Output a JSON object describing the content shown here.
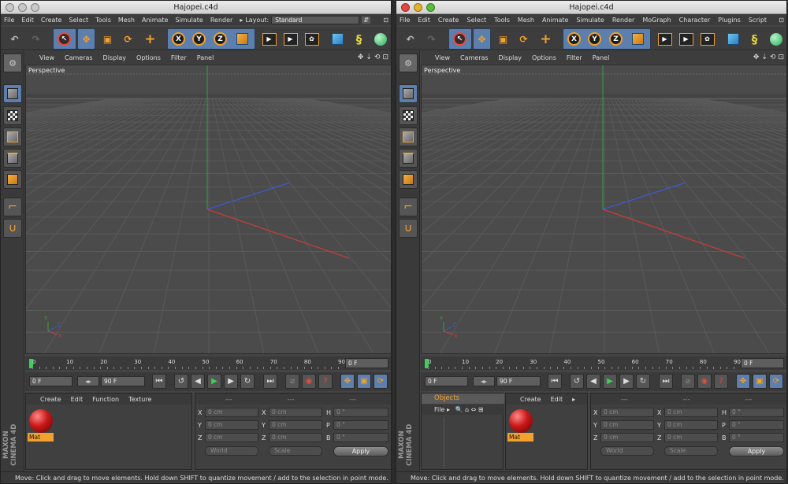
{
  "windows": [
    {
      "title": "Hajopei.c4d",
      "menu": [
        "File",
        "Edit",
        "Create",
        "Select",
        "Tools",
        "Mesh",
        "Animate",
        "Simulate",
        "Render"
      ],
      "layout_label": "Layout:",
      "layout_value": "Standard",
      "traffic_lights_active": false
    },
    {
      "title": "Hajopei.c4d",
      "menu": [
        "File",
        "Edit",
        "Create",
        "Select",
        "Tools",
        "Mesh",
        "Animate",
        "Simulate",
        "Render",
        "MoGraph",
        "Character",
        "Plugins",
        "Script"
      ],
      "traffic_lights_active": true
    }
  ],
  "viewport_menu": [
    "View",
    "Cameras",
    "Display",
    "Options",
    "Filter",
    "Panel"
  ],
  "viewport_label": "Perspective",
  "timeline": {
    "ticks": [
      "0",
      "10",
      "20",
      "30",
      "40",
      "50",
      "60",
      "70",
      "80",
      "90"
    ],
    "end_frame": "0 F",
    "start_field": "0 F",
    "max_field": "90 F"
  },
  "material_menu": [
    "Create",
    "Edit",
    "Function",
    "Texture"
  ],
  "material_menu_right": [
    "Create",
    "Edit"
  ],
  "material_name": "Mat",
  "objects_tab": "Objects",
  "objects_file_menu": "File",
  "attributes": {
    "header": [
      "---",
      "---",
      "---"
    ],
    "rows": [
      {
        "a": "X",
        "a_val": "0 cm",
        "b": "X",
        "b_val": "0 cm",
        "c": "H",
        "c_val": "0 °"
      },
      {
        "a": "Y",
        "a_val": "0 cm",
        "b": "Y",
        "b_val": "0 cm",
        "c": "P",
        "c_val": "0 °"
      },
      {
        "a": "Z",
        "a_val": "0 cm",
        "b": "Z",
        "b_val": "0 cm",
        "c": "B",
        "c_val": "0 °"
      }
    ],
    "coord_mode": "World",
    "transform_mode": "Scale",
    "apply_label": "Apply"
  },
  "brand": "MAXON CINEMA 4D",
  "status_text": "Move: Click and drag to move elements. Hold down SHIFT to quantize movement / add to the selection in point mode.",
  "axis_labels": {
    "x": "X",
    "y": "Y",
    "z": "Z"
  },
  "colors": {
    "accent": "#f1a12d",
    "active_blue": "#5c7fae",
    "axis_x": "#c83c3c",
    "axis_y": "#3ca03c",
    "axis_z": "#3c5ad2",
    "play": "#3bd05a"
  }
}
